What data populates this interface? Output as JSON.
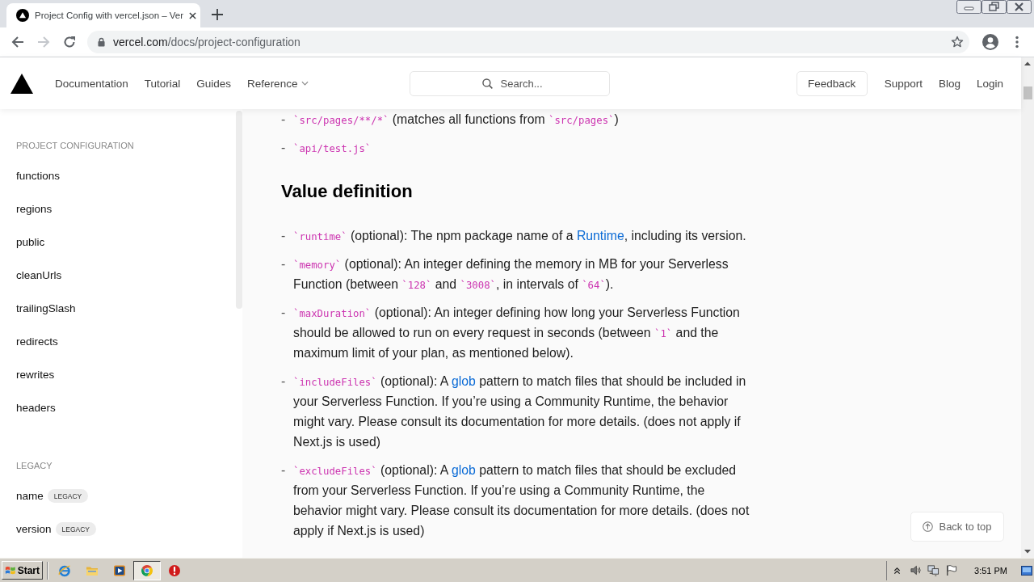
{
  "browser": {
    "tab": {
      "title": "Project Config with vercel.json – Ver"
    },
    "nav_buttons": [
      {
        "disabled": false
      },
      {
        "disabled": true
      },
      {
        "disabled": false
      }
    ],
    "url": {
      "host": "vercel.com",
      "path": "/docs/project-configuration"
    }
  },
  "site_header": {
    "nav": [
      {
        "label": "Documentation",
        "dropdown": false
      },
      {
        "label": "Tutorial",
        "dropdown": false
      },
      {
        "label": "Guides",
        "dropdown": false
      },
      {
        "label": "Reference",
        "dropdown": true
      }
    ],
    "search": {
      "placeholder": "Search..."
    },
    "feedback": "Feedback",
    "links": [
      "Support",
      "Blog",
      "Login"
    ]
  },
  "sidebar": {
    "sections": [
      {
        "title": "PROJECT CONFIGURATION",
        "items": [
          {
            "label": "functions"
          },
          {
            "label": "regions"
          },
          {
            "label": "public"
          },
          {
            "label": "cleanUrls"
          },
          {
            "label": "trailingSlash"
          },
          {
            "label": "redirects"
          },
          {
            "label": "rewrites"
          },
          {
            "label": "headers"
          }
        ]
      },
      {
        "title": "LEGACY",
        "items": [
          {
            "label": "name",
            "badge": "LEGACY"
          },
          {
            "label": "version",
            "badge": "LEGACY"
          }
        ]
      }
    ]
  },
  "content": {
    "paths": [
      {
        "bullet": "-",
        "parts": [
          {
            "kind": "code",
            "text": "`src/pages/**/*`"
          },
          {
            "kind": "text",
            "text": " (matches all functions from "
          },
          {
            "kind": "code",
            "text": "`src/pages`"
          },
          {
            "kind": "text",
            "text": ")"
          }
        ]
      },
      {
        "bullet": "-",
        "parts": [
          {
            "kind": "code",
            "text": "`api/test.js`"
          }
        ]
      }
    ],
    "heading": "Value definition",
    "definitions": [
      {
        "bullet": "-",
        "parts": [
          {
            "kind": "code",
            "text": "`runtime`"
          },
          {
            "kind": "text",
            "text": " (optional): The npm package name of a "
          },
          {
            "kind": "link",
            "text": "Runtime"
          },
          {
            "kind": "text",
            "text": ", including its version."
          }
        ]
      },
      {
        "bullet": "-",
        "parts": [
          {
            "kind": "code",
            "text": "`memory`"
          },
          {
            "kind": "text",
            "text": " (optional): An integer defining the memory in MB for your Serverless Function (between "
          },
          {
            "kind": "code",
            "text": "`128`"
          },
          {
            "kind": "text",
            "text": " and "
          },
          {
            "kind": "code",
            "text": "`3008`"
          },
          {
            "kind": "text",
            "text": ", in intervals of "
          },
          {
            "kind": "code",
            "text": "`64`"
          },
          {
            "kind": "text",
            "text": ")."
          }
        ]
      },
      {
        "bullet": "-",
        "parts": [
          {
            "kind": "code",
            "text": "`maxDuration`"
          },
          {
            "kind": "text",
            "text": " (optional): An integer defining how long your Serverless Function should be allowed to run on every request in seconds (between "
          },
          {
            "kind": "code",
            "text": "`1`"
          },
          {
            "kind": "text",
            "text": " and the maximum limit of your plan, as mentioned below)."
          }
        ]
      },
      {
        "bullet": "-",
        "parts": [
          {
            "kind": "code",
            "text": "`includeFiles`"
          },
          {
            "kind": "text",
            "text": " (optional): A "
          },
          {
            "kind": "link",
            "text": "glob"
          },
          {
            "kind": "text",
            "text": " pattern to match files that should be included in your Serverless Function. If you’re using a Community Runtime, the behavior might vary. Please consult its documentation for more details. (does not apply if Next.js is used)"
          }
        ]
      },
      {
        "bullet": "-",
        "parts": [
          {
            "kind": "code",
            "text": "`excludeFiles`"
          },
          {
            "kind": "text",
            "text": " (optional): A "
          },
          {
            "kind": "link",
            "text": "glob"
          },
          {
            "kind": "text",
            "text": " pattern to match files that should be excluded from your Serverless Function. If you’re using a Community Runtime, the behavior might vary. Please consult its documentation for more details. (does not apply if Next.js is used)"
          }
        ]
      }
    ]
  },
  "back_to_top": "Back to top",
  "taskbar": {
    "start": "Start",
    "apps": [
      {
        "selected": false
      },
      {
        "selected": false
      },
      {
        "selected": false
      },
      {
        "selected": true
      },
      {
        "selected": false
      }
    ],
    "clock": "3:51 PM"
  }
}
